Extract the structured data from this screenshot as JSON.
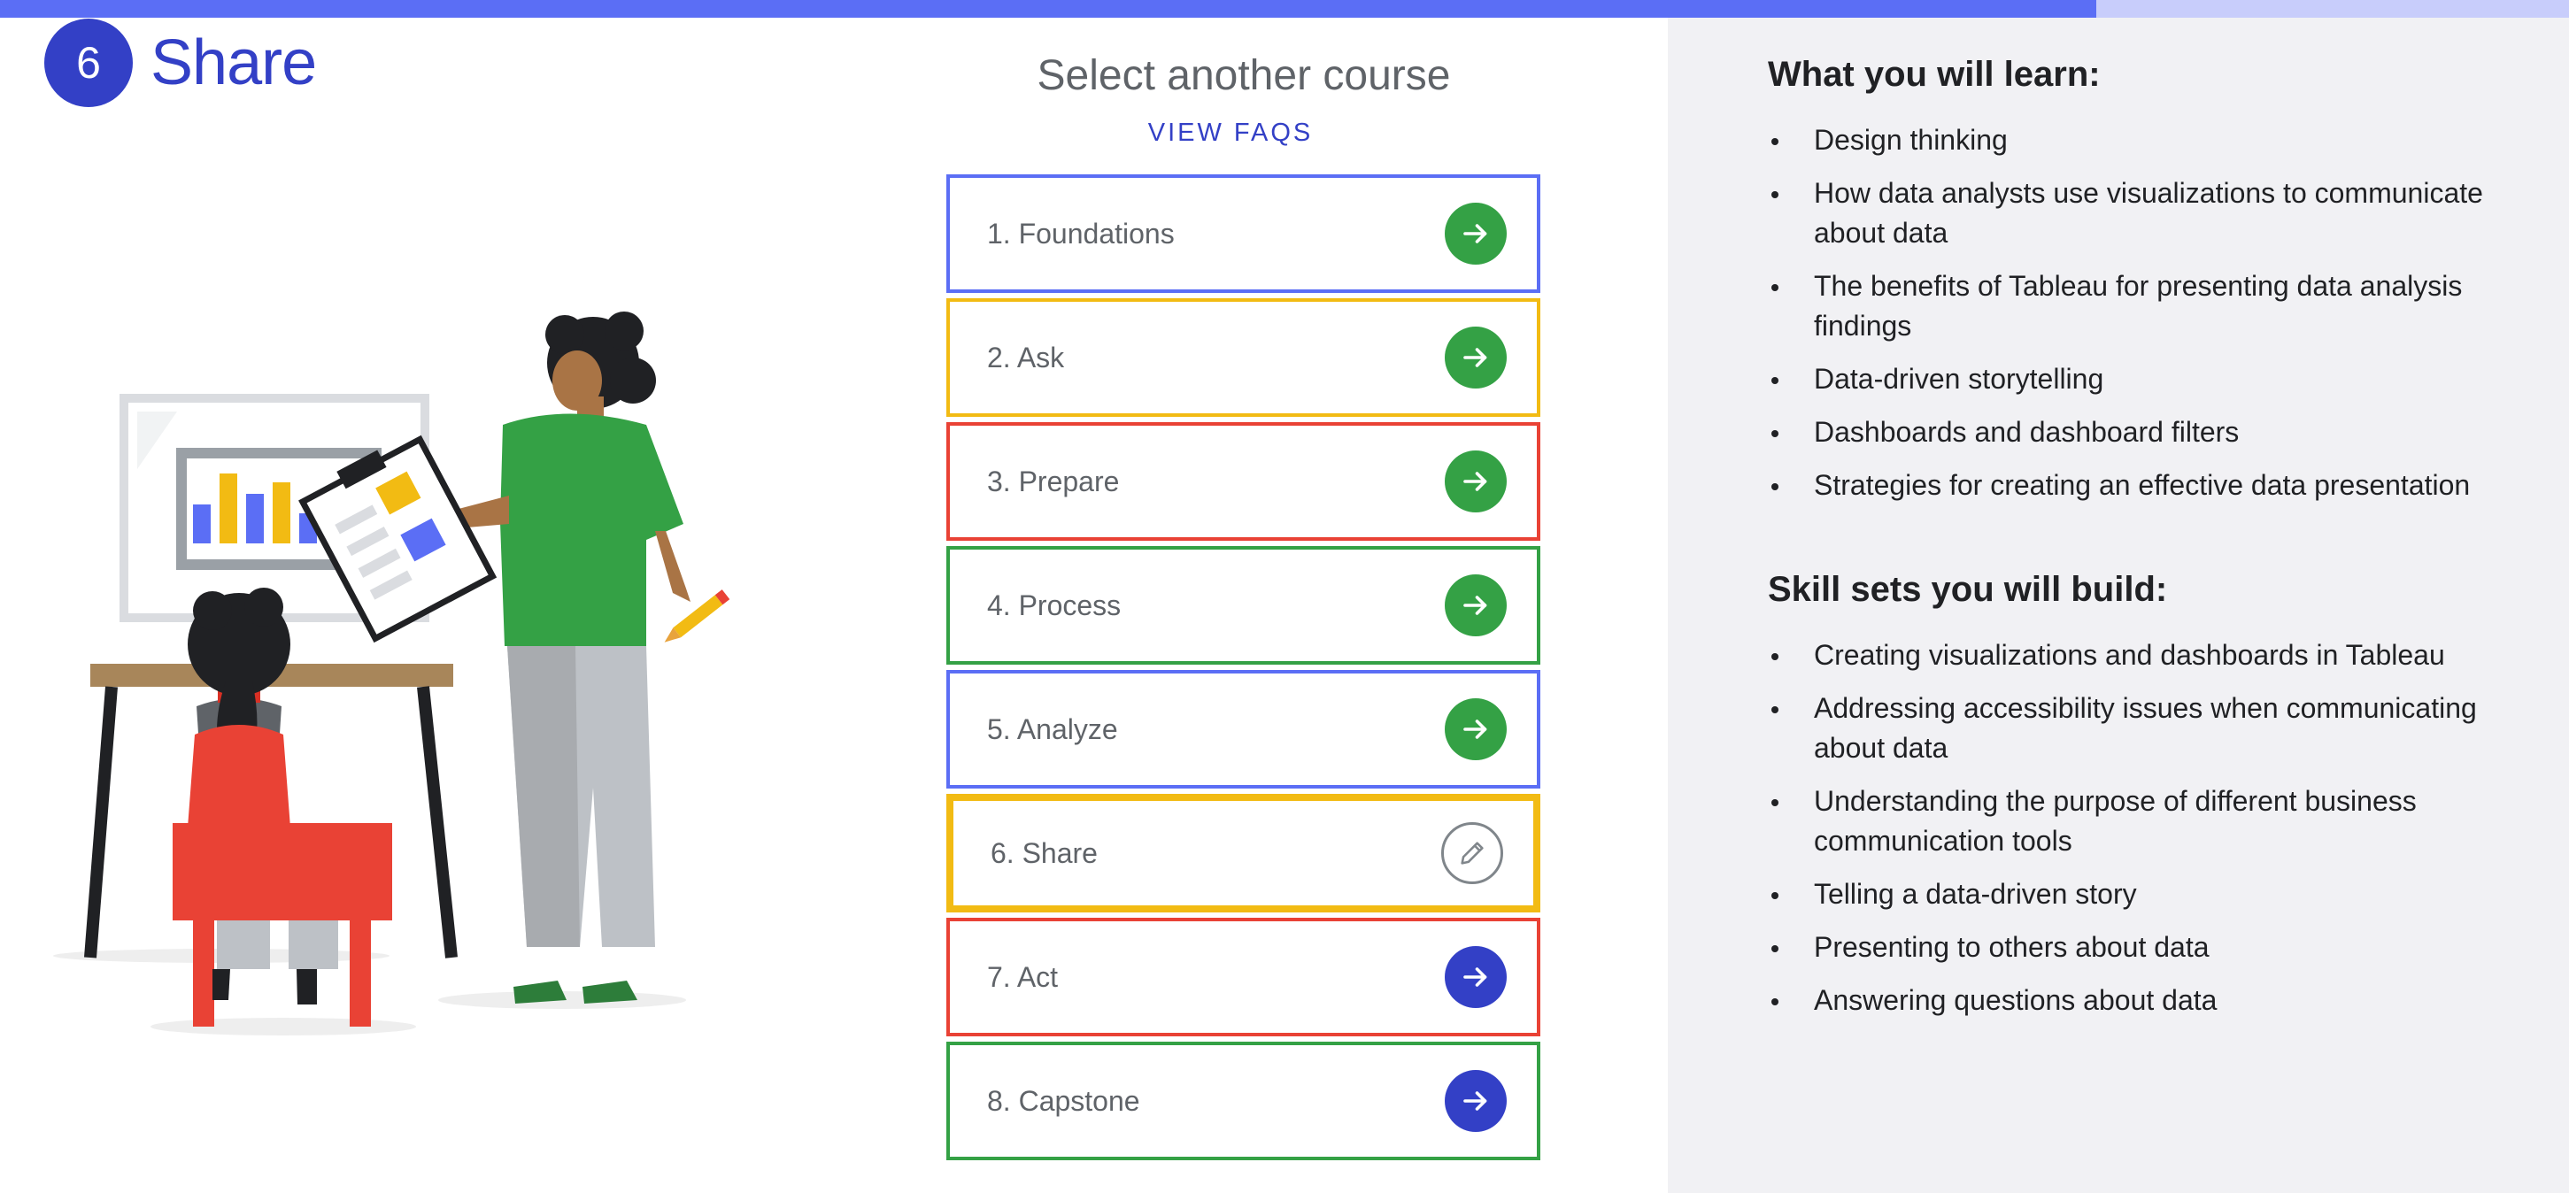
{
  "progress": {
    "fraction": 0.816,
    "fill_color": "#5b6ef5",
    "track_color": "#c8cdfb"
  },
  "header": {
    "number": "6",
    "title": "Share"
  },
  "courses_panel": {
    "title": "Select another course",
    "faq_label": "VIEW FAQS",
    "courses": [
      {
        "label": "1. Foundations",
        "border_color": "#5b6ef5",
        "state": "available",
        "button_color": "#34a145",
        "icon": "arrow-right-icon"
      },
      {
        "label": "2. Ask",
        "border_color": "#f2bb13",
        "state": "available",
        "button_color": "#34a145",
        "icon": "arrow-right-icon"
      },
      {
        "label": "3. Prepare",
        "border_color": "#e94235",
        "state": "available",
        "button_color": "#34a145",
        "icon": "arrow-right-icon"
      },
      {
        "label": "4. Process",
        "border_color": "#34a145",
        "state": "available",
        "button_color": "#34a145",
        "icon": "arrow-right-icon"
      },
      {
        "label": "5. Analyze",
        "border_color": "#5b6ef5",
        "state": "available",
        "button_color": "#34a145",
        "icon": "arrow-right-icon"
      },
      {
        "label": "6. Share",
        "border_color": "#f2bb13",
        "state": "current",
        "button_color": "#ffffff",
        "icon": "pencil-icon"
      },
      {
        "label": "7. Act",
        "border_color": "#e94235",
        "state": "available",
        "button_color": "#3340c6",
        "icon": "arrow-right-icon"
      },
      {
        "label": "8. Capstone",
        "border_color": "#34a145",
        "state": "available",
        "button_color": "#3340c6",
        "icon": "arrow-right-icon"
      }
    ]
  },
  "learn": {
    "heading": "What you will learn:",
    "items": [
      "Design thinking",
      "How data analysts use visualizations to communicate about data",
      "The benefits of Tableau for presenting data analysis findings",
      "Data-driven storytelling",
      "Dashboards and dashboard filters",
      "Strategies for creating an effective data presentation"
    ]
  },
  "skills": {
    "heading": "Skill sets you will build:",
    "items": [
      "Creating visualizations and dashboards in Tableau",
      "Addressing accessibility issues when communicating about data",
      "Understanding the purpose of different business communication tools",
      "Telling a data-driven story",
      "Presenting to others about data",
      "Answering questions about data"
    ]
  },
  "colors": {
    "brand_blue": "#3340c6",
    "green": "#34a145",
    "yellow": "#f2bb13",
    "red": "#e94235"
  }
}
